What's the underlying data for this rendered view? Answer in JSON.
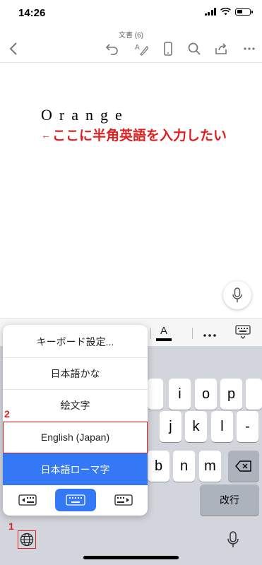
{
  "status": {
    "time": "14:26"
  },
  "doc": {
    "title": "文書 (6)",
    "body_text": "Orange",
    "annotation": "ここに半角英語を入力したい",
    "annotation_arrow": "←"
  },
  "format_bar": {
    "font_color_label": "A"
  },
  "popup": {
    "items": [
      "キーボード設定...",
      "日本語かな",
      "絵文字",
      "English (Japan)",
      "日本語ローマ字"
    ],
    "selected": "日本語ローマ字"
  },
  "keyboard": {
    "row1": [
      "i",
      "o",
      "p"
    ],
    "row2": [
      "j",
      "k",
      "l",
      "-"
    ],
    "row3": [
      "b",
      "n",
      "m"
    ],
    "return_label": "改行"
  },
  "markers": {
    "one": "1",
    "two": "2"
  },
  "colors": {
    "accent": "#3478f6",
    "annotation": "#e02020"
  }
}
